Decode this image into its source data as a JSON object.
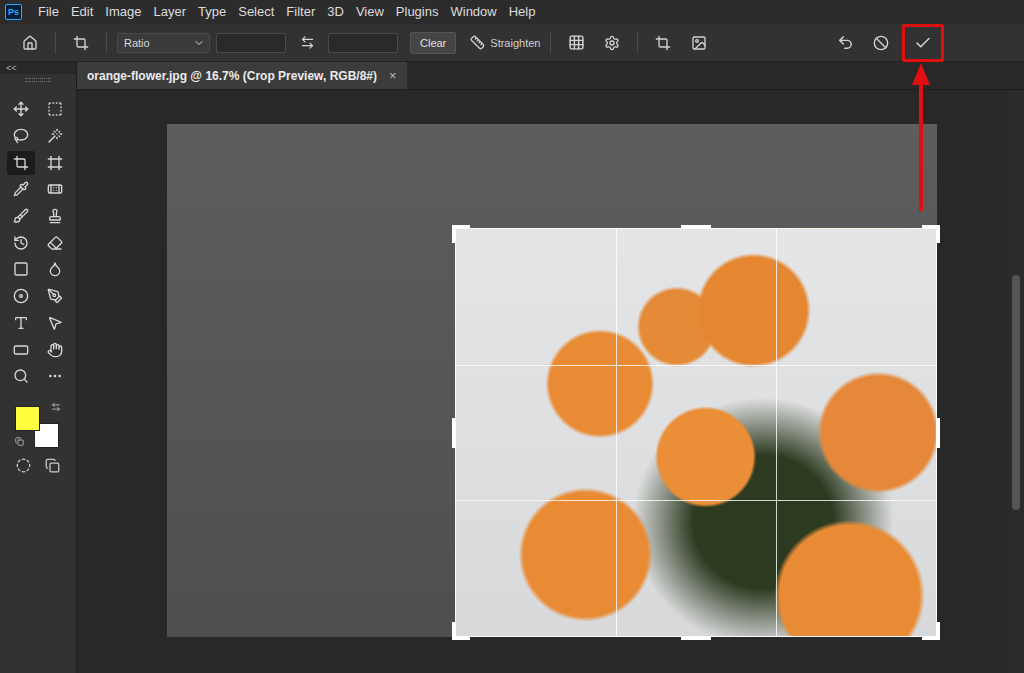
{
  "app": {
    "logo": "Ps"
  },
  "menu": [
    "File",
    "Edit",
    "Image",
    "Layer",
    "Type",
    "Select",
    "Filter",
    "3D",
    "View",
    "Plugins",
    "Window",
    "Help"
  ],
  "options_bar": {
    "ratio": {
      "value": "Ratio"
    },
    "width": {
      "value": ""
    },
    "height": {
      "value": ""
    },
    "clear": "Clear",
    "straighten": "Straighten",
    "commit": {
      "highlighted": true
    }
  },
  "panel": {
    "collapse": "<<"
  },
  "tools": [
    {
      "selected": false
    },
    {
      "selected": false
    },
    {
      "selected": false
    },
    {
      "selected": false
    },
    {
      "selected": true
    },
    {
      "selected": false
    },
    {
      "selected": false
    },
    {
      "selected": false
    },
    {
      "selected": false
    },
    {
      "selected": false
    },
    {
      "selected": false
    },
    {
      "selected": false
    },
    {
      "selected": false
    },
    {
      "selected": false
    },
    {
      "selected": false
    },
    {
      "selected": false
    },
    {
      "selected": false
    },
    {
      "selected": false
    },
    {
      "selected": false
    },
    {
      "selected": false
    },
    {
      "selected": false
    },
    {
      "selected": false
    }
  ],
  "swatches": [
    {
      "name": "foreground",
      "color": "#ffff40"
    },
    {
      "name": "background",
      "color": "#ffffff"
    }
  ],
  "document": {
    "tab": "orange-flower.jpg @ 16.7% (Crop Preview, RGB/8#)",
    "close": "×"
  }
}
